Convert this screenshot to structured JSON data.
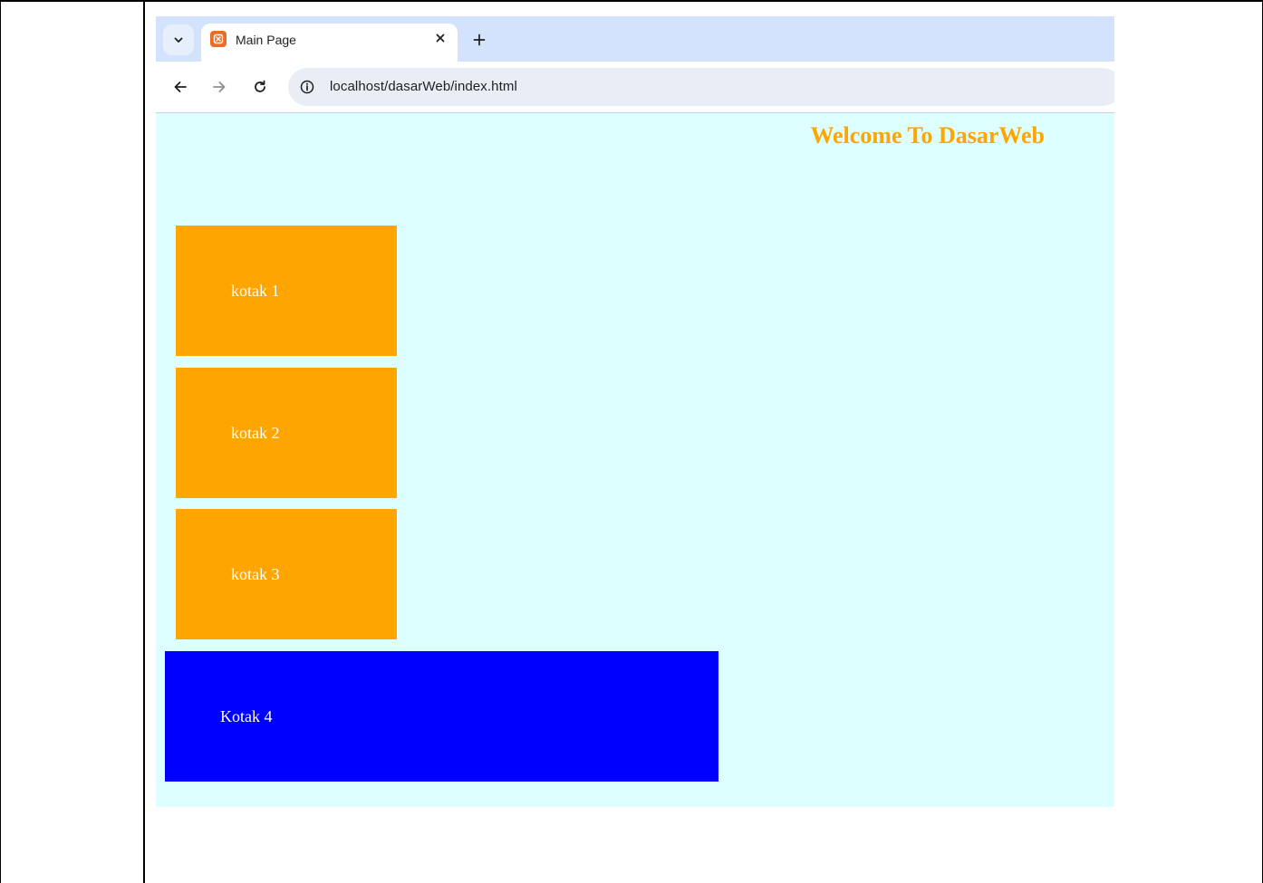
{
  "browser": {
    "tab": {
      "title": "Main Page"
    },
    "address_bar": {
      "url": "localhost/dasarWeb/index.html"
    },
    "icons": {
      "tab_search": "chevron-down-icon",
      "favicon": "xampp-icon",
      "close": "close-icon",
      "new_tab": "plus-icon",
      "back": "arrow-left-icon",
      "forward": "arrow-right-icon",
      "reload": "reload-icon",
      "site_info": "info-icon"
    }
  },
  "page": {
    "heading": "Welcome To DasarWeb",
    "boxes": [
      {
        "label": "kotak 1",
        "color": "#ffa500"
      },
      {
        "label": "kotak 2",
        "color": "#ffa500"
      },
      {
        "label": "kotak 3",
        "color": "#ffa500"
      },
      {
        "label": "Kotak 4",
        "color": "#0000ff"
      }
    ],
    "background_color": "#ddffff",
    "heading_color": "#ffa500"
  }
}
